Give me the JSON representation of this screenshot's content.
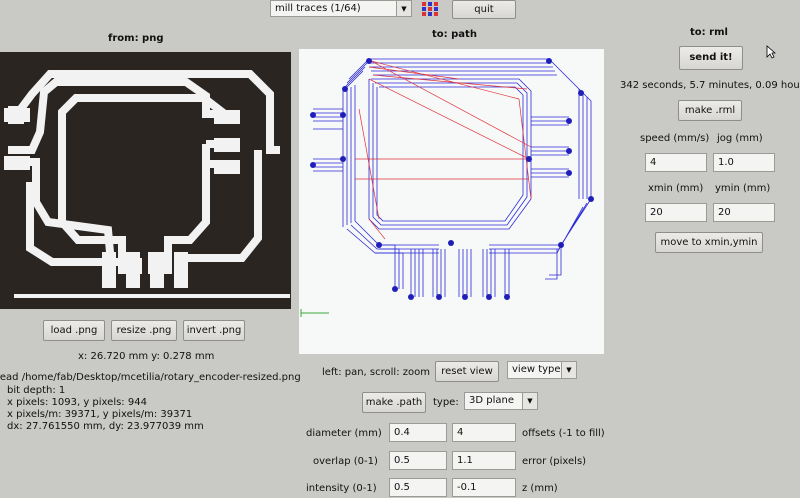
{
  "toolbar": {
    "process_select": "mill traces (1/64)",
    "quit_label": "quit",
    "grid_icon": "grid-icon"
  },
  "left_panel": {
    "header": "from: png",
    "load_label": "load .png",
    "resize_label": "resize .png",
    "invert_label": "invert .png",
    "coords": "x: 26.720 mm  y: 0.278 mm",
    "info_lines": [
      "read /home/fab/Desktop/mcetilia/rotary_encoder-resized.png",
      "bit depth: 1",
      "x pixels: 1093, y pixels: 944",
      "x pixels/m: 39371, y pixels/m: 39371",
      "dx: 27.761550 mm, dy: 23.977039 mm"
    ]
  },
  "center_panel": {
    "header": "to: path",
    "help_text": "left: pan, scroll: zoom",
    "reset_view_label": "reset view",
    "view_type_select": "view type",
    "make_path_label": "make .path",
    "type_label": "type:",
    "type_select": "3D plane",
    "params": [
      {
        "label": "diameter (mm)",
        "value1": "0.4",
        "value2": "4",
        "suffix": "offsets (-1 to fill)"
      },
      {
        "label": "overlap (0-1)",
        "value1": "0.5",
        "value2": "1.1",
        "suffix": "error (pixels)"
      },
      {
        "label": "intensity (0-1)",
        "value1": "0.5",
        "value2": "-0.1",
        "suffix": "z (mm)"
      }
    ]
  },
  "right_panel": {
    "header": "to: rml",
    "send_label": "send it!",
    "time_estimate": "342 seconds, 5.7 minutes, 0.09 hour",
    "make_rml_label": "make .rml",
    "speed_label": "speed (mm/s)",
    "jog_label": "jog (mm)",
    "speed_value": "4",
    "jog_value": "1.0",
    "xmin_label": "xmin (mm)",
    "ymin_label": "ymin (mm)",
    "xmin_value": "20",
    "ymin_value": "20",
    "move_label": "move to xmin,ymin"
  },
  "colors": {
    "background": "#c9c9c6",
    "toolpath_blue": "#2a2ad6",
    "travel_red": "#e0303a",
    "trace_white": "#f2f2f2",
    "board_dark": "#2a2521"
  }
}
